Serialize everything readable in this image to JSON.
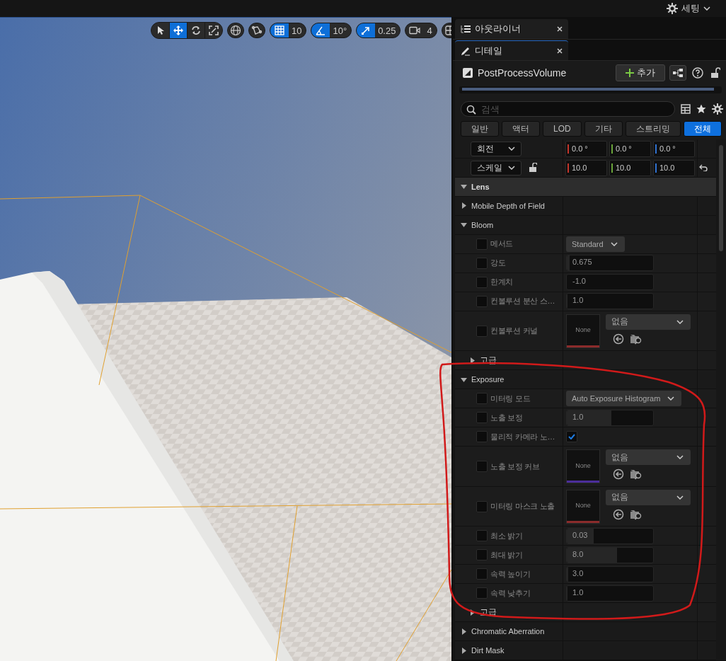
{
  "top_bar": {
    "settings_label": "세팅"
  },
  "viewport_toolbar": [
    {
      "kind": "segmented",
      "items": [
        {
          "selected": false
        },
        {
          "selected": true
        },
        {
          "selected": false
        },
        {
          "selected": false
        }
      ]
    },
    {
      "kind": "icon"
    },
    {
      "kind": "icon"
    },
    {
      "kind": "snap",
      "on": true,
      "value": "10"
    },
    {
      "kind": "snap",
      "on": true,
      "value": "10°"
    },
    {
      "kind": "snap",
      "on": true,
      "value": "0.25"
    },
    {
      "kind": "snap",
      "on": false,
      "value": "4"
    },
    {
      "kind": "icon"
    }
  ],
  "panel_tabs": [
    {
      "label": "아웃라이너",
      "selected": false
    },
    {
      "label": "디테일",
      "selected": true
    }
  ],
  "details": {
    "title": "PostProcessVolume",
    "add_button": "추가",
    "search": {
      "placeholder": "검색"
    },
    "filters": [
      {
        "label": "일반",
        "selected": false
      },
      {
        "label": "액터",
        "selected": false
      },
      {
        "label": "LOD",
        "selected": false
      },
      {
        "label": "기타",
        "selected": false
      },
      {
        "label": "스트리밍",
        "selected": false
      },
      {
        "label": "전체",
        "selected": true
      }
    ],
    "transform_rows": [
      {
        "label": "회전",
        "values": [
          "0.0 °",
          "0.0 °",
          "0.0 °"
        ]
      },
      {
        "label": "스케일",
        "locked": false,
        "reset": true,
        "values": [
          "10.0",
          "10.0",
          "10.0"
        ]
      }
    ],
    "sections": [
      {
        "kind": "category",
        "label": "Lens",
        "expanded": true,
        "children": [
          {
            "kind": "group",
            "label": "Mobile Depth of Field",
            "expanded": false
          },
          {
            "kind": "group",
            "label": "Bloom",
            "expanded": true,
            "children": [
              {
                "kind": "dropdown",
                "label": "메서드",
                "checked": false,
                "value": "Standard"
              },
              {
                "kind": "slider",
                "label": "강도",
                "checked": false,
                "value": "0.675",
                "level": 0.03
              },
              {
                "kind": "slider",
                "label": "한계치",
                "checked": false,
                "value": "-1.0"
              },
              {
                "kind": "slider",
                "label": "컨볼루션 분산 스…",
                "checked": false,
                "value": "1.0",
                "level": 0.01
              },
              {
                "kind": "asset",
                "label": "컨볼루션 커널",
                "checked": false,
                "thumbnail": "None",
                "value": "없음",
                "color": "#8b2b2b"
              },
              {
                "kind": "group",
                "label": "고급",
                "expanded": false
              }
            ]
          },
          {
            "kind": "group",
            "label": "Exposure",
            "expanded": true,
            "children": [
              {
                "kind": "dropdown",
                "label": "미터링 모드",
                "checked": false,
                "value": "Auto Exposure Histogram"
              },
              {
                "kind": "slider",
                "label": "노출 보정",
                "checked": false,
                "value": "1.0",
                "level": 0.52
              },
              {
                "kind": "checkbox",
                "label": "물리적 카메라 노…",
                "checked": false,
                "value_checked": true
              },
              {
                "kind": "asset",
                "label": "노출 보정 커브",
                "checked": false,
                "thumbnail": "None",
                "value": "없음",
                "color": "#4b2d9a"
              },
              {
                "kind": "asset",
                "label": "미터링 마스크 노출",
                "checked": false,
                "thumbnail": "None",
                "value": "없음",
                "color": "#8b2b2b"
              },
              {
                "kind": "slider",
                "label": "최소 밝기",
                "checked": false,
                "value": "0.03",
                "level": 0.31
              },
              {
                "kind": "slider",
                "label": "최대 밝기",
                "checked": false,
                "value": "8.0",
                "level": 0.58
              },
              {
                "kind": "slider",
                "label": "속력 높이기",
                "checked": false,
                "value": "3.0",
                "level": 0.02
              },
              {
                "kind": "slider",
                "label": "속력 낮추기",
                "checked": false,
                "value": "1.0",
                "level": 0.01
              },
              {
                "kind": "group",
                "label": "고급",
                "expanded": false
              }
            ]
          },
          {
            "kind": "group",
            "label": "Chromatic Aberration",
            "expanded": false
          },
          {
            "kind": "group",
            "label": "Dirt Mask",
            "expanded": false
          }
        ]
      }
    ]
  }
}
